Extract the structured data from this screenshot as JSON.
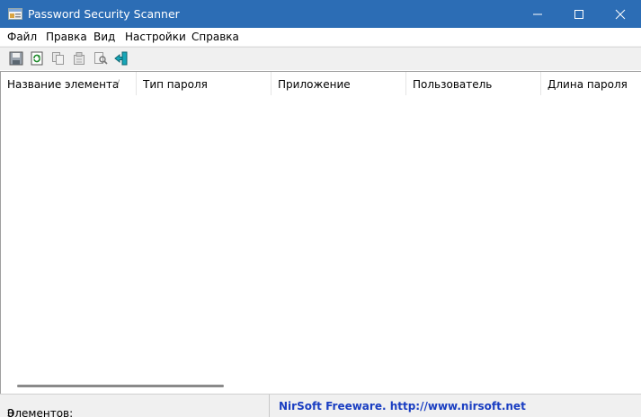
{
  "window": {
    "title": "Password Security Scanner",
    "icon": "app-window-icon",
    "controls": [
      "minimize-icon",
      "maximize-icon",
      "close-icon"
    ],
    "titlebar_color": "#2c6db5"
  },
  "menu": {
    "items": [
      "Файл",
      "Правка",
      "Вид",
      "Настройки",
      "Справка"
    ]
  },
  "toolbar": {
    "icons": [
      "save-icon",
      "refresh-icon",
      "copy-icon",
      "properties-icon",
      "find-icon",
      "exit-icon"
    ]
  },
  "table": {
    "columns": [
      "Название элемента",
      "Тип пароля",
      "Приложение",
      "Пользователь",
      "Длина пароля"
    ],
    "sort_indicator": "/",
    "rows": []
  },
  "status": {
    "items_label": "Элементов:",
    "items_count": "0",
    "credit": "NirSoft Freeware.  http://www.nirsoft.net",
    "credit_color": "#1a3ec2"
  }
}
